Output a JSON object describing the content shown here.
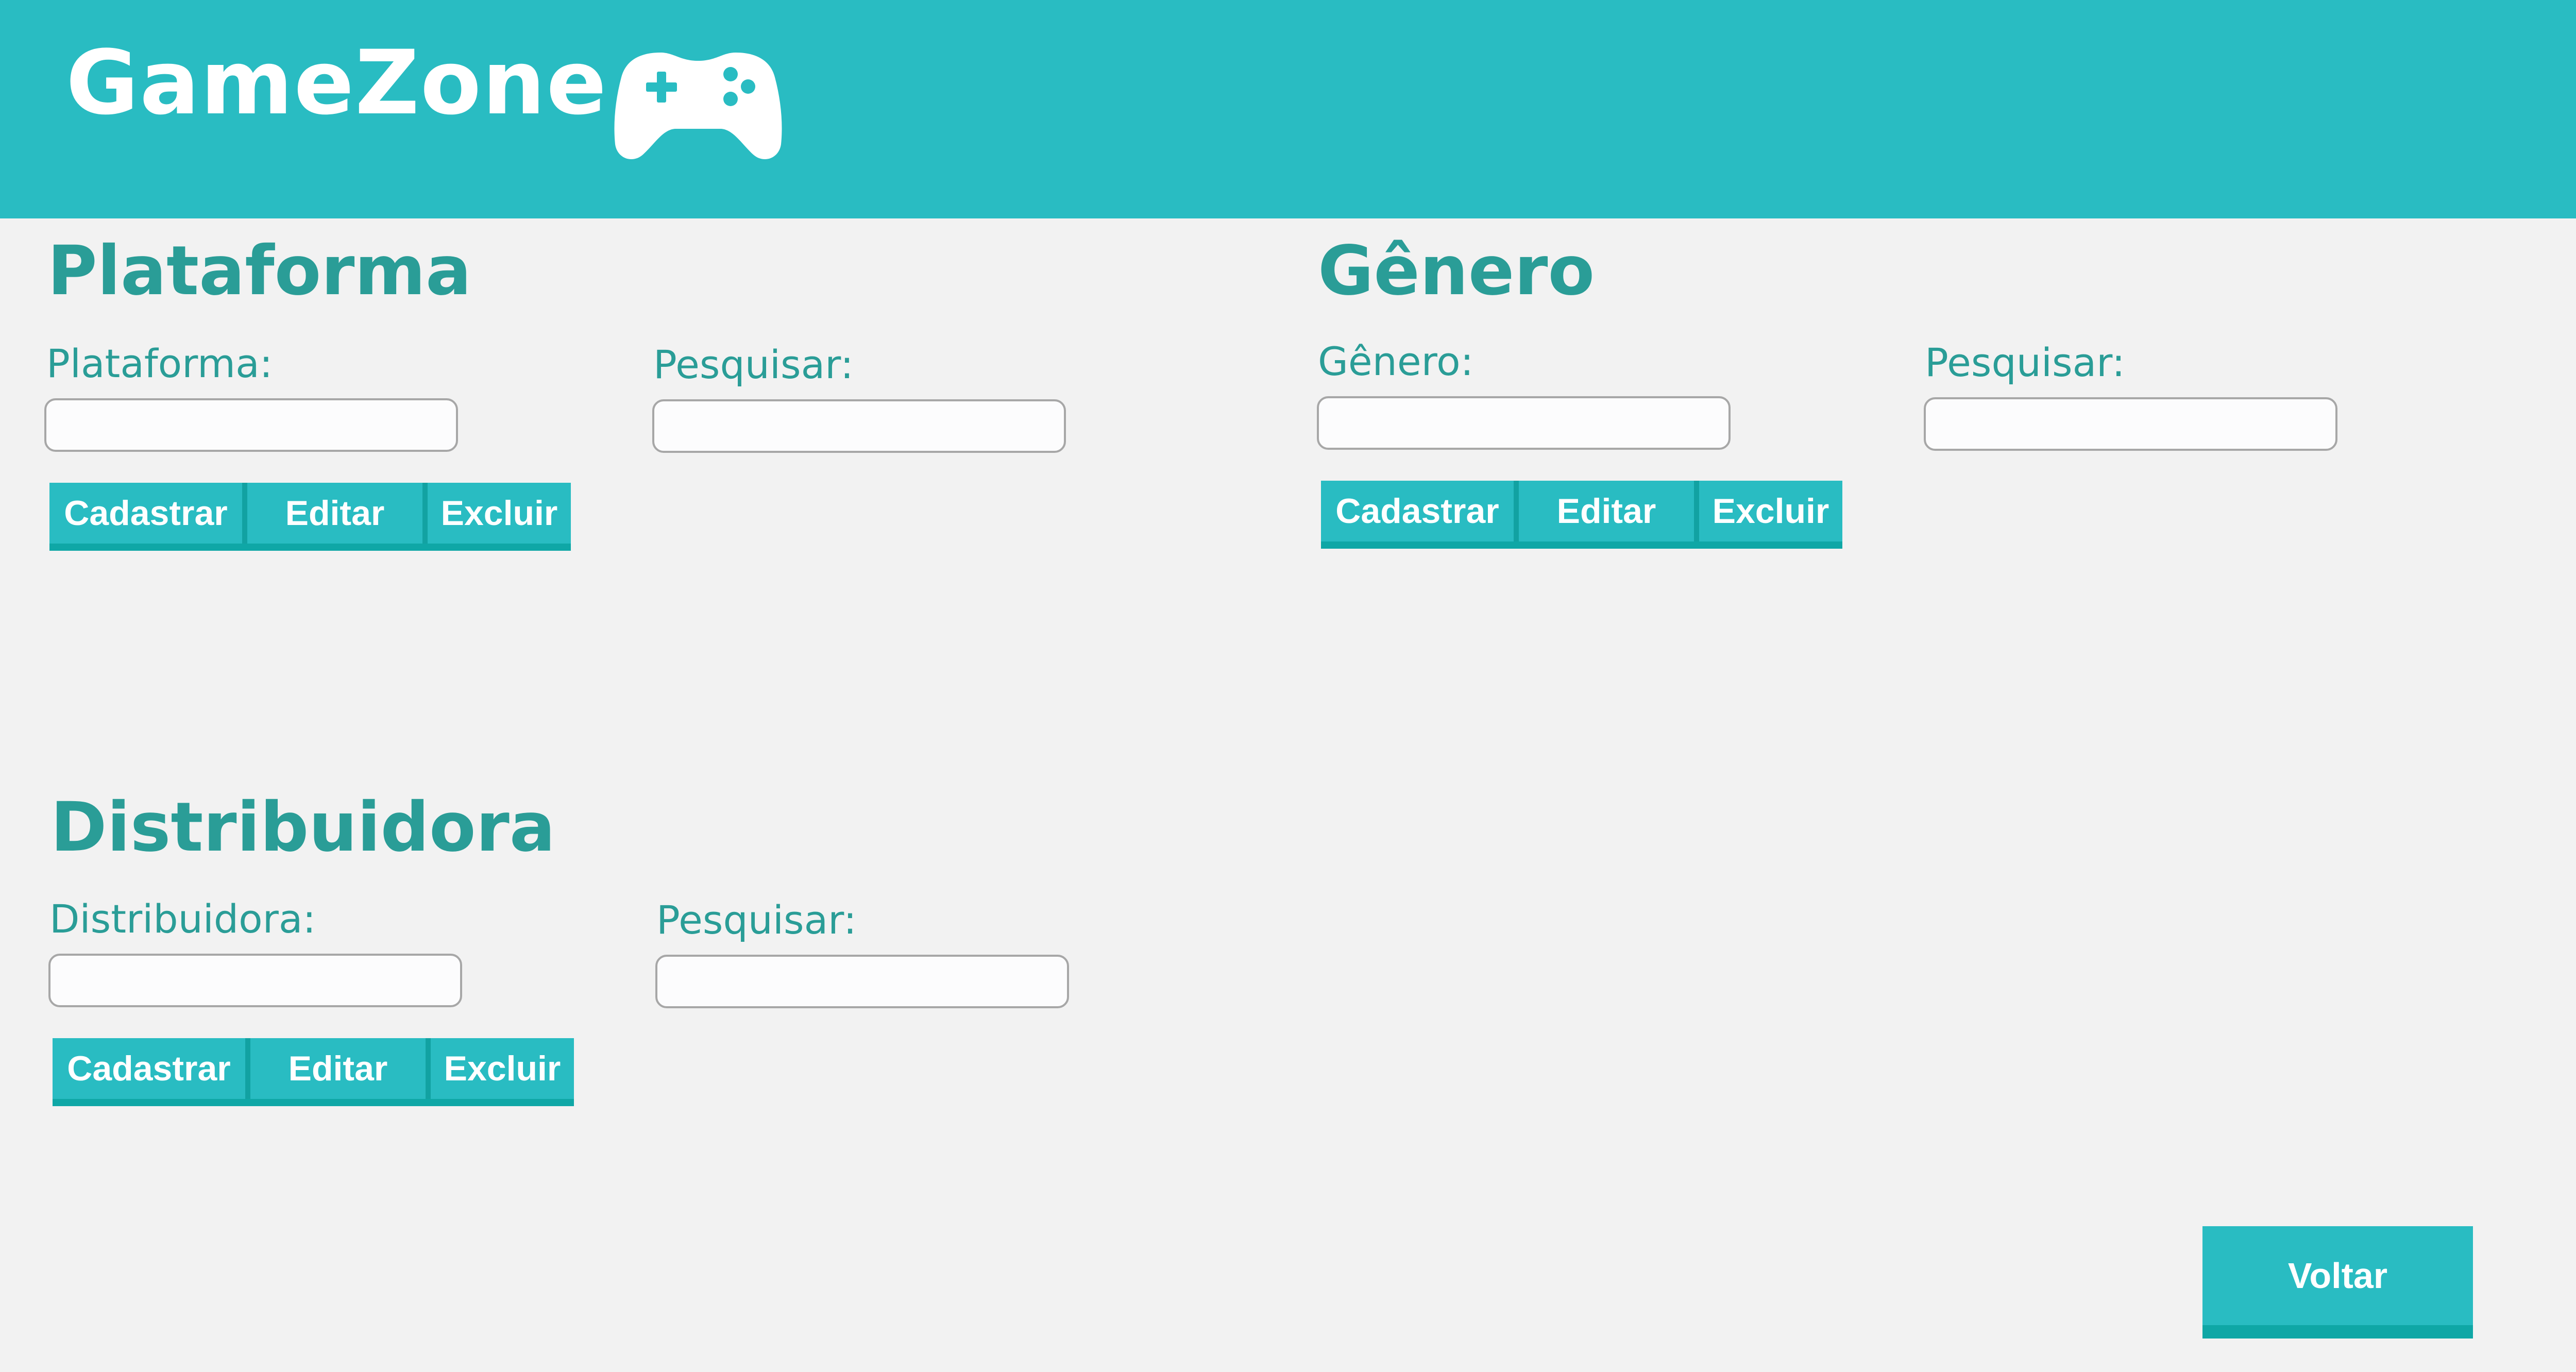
{
  "header": {
    "brand": "GameZone",
    "icon": "gamepad-icon",
    "background": "#29bcc2"
  },
  "sections": {
    "plataforma": {
      "title": "Plataforma",
      "field_label": "Plataforma:",
      "field_value": "",
      "search_label": "Pesquisar:",
      "search_value": "",
      "buttons": {
        "create": "Cadastrar",
        "edit": "Editar",
        "delete": "Excluir"
      }
    },
    "genero": {
      "title": "Gênero",
      "field_label": "Gênero:",
      "field_value": "",
      "search_label": "Pesquisar:",
      "search_value": "",
      "buttons": {
        "create": "Cadastrar",
        "edit": "Editar",
        "delete": "Excluir"
      }
    },
    "distribuidora": {
      "title": "Distribuidora",
      "field_label": "Distribuidora:",
      "field_value": "",
      "search_label": "Pesquisar:",
      "search_value": "",
      "buttons": {
        "create": "Cadastrar",
        "edit": "Editar",
        "delete": "Excluir"
      }
    }
  },
  "footer": {
    "back_label": "Voltar"
  },
  "colors": {
    "accent": "#29bcc2",
    "accent_dark": "#0fa7a6",
    "title_text": "#2a9d97",
    "page_background": "#f2f2f2"
  }
}
